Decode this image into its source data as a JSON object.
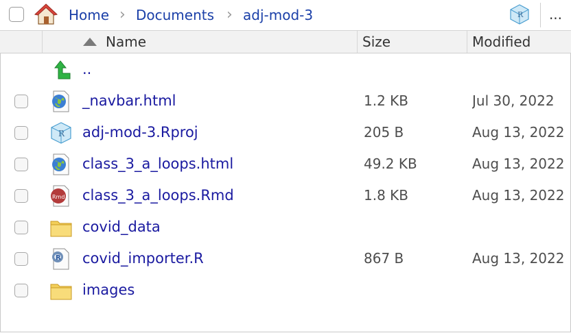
{
  "breadcrumb": {
    "items": [
      "Home",
      "Documents",
      "adj-mod-3"
    ],
    "separator": "›"
  },
  "toolbar": {
    "more_label": "..."
  },
  "columns": {
    "name": "Name",
    "size": "Size",
    "modified": "Modified"
  },
  "files": [
    {
      "name": "..",
      "size": "",
      "modified": "",
      "icon": "up-arrow-icon",
      "checkbox": false
    },
    {
      "name": "_navbar.html",
      "size": "1.2 KB",
      "modified": "Jul 30, 2022",
      "icon": "html-file-icon",
      "checkbox": true
    },
    {
      "name": "adj-mod-3.Rproj",
      "size": "205 B",
      "modified": "Aug 13, 2022",
      "icon": "rproj-file-icon",
      "checkbox": true
    },
    {
      "name": "class_3_a_loops.html",
      "size": "49.2 KB",
      "modified": "Aug 13, 2022",
      "icon": "html-file-icon",
      "checkbox": true
    },
    {
      "name": "class_3_a_loops.Rmd",
      "size": "1.8 KB",
      "modified": "Aug 13, 2022",
      "icon": "rmd-file-icon",
      "checkbox": true
    },
    {
      "name": "covid_data",
      "size": "",
      "modified": "",
      "icon": "folder-icon",
      "checkbox": true
    },
    {
      "name": "covid_importer.R",
      "size": "867 B",
      "modified": "Aug 13, 2022",
      "icon": "r-script-icon",
      "checkbox": true
    },
    {
      "name": "images",
      "size": "",
      "modified": "",
      "icon": "folder-icon",
      "checkbox": true
    }
  ],
  "colors": {
    "link": "#1a1aa0",
    "breadcrumb": "#1a3fa8",
    "header_bg": "#f2f2f2",
    "folder": "#f3cf5a",
    "up_arrow": "#2fb344"
  }
}
